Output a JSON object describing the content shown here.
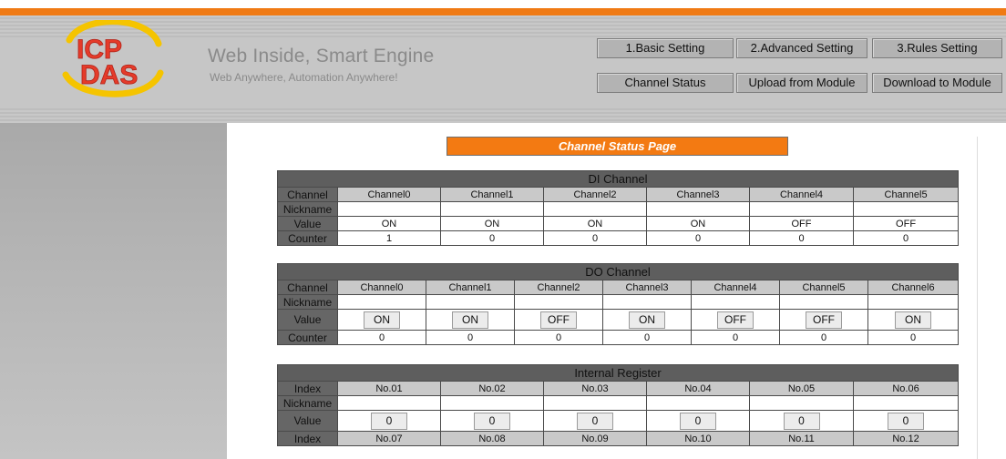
{
  "brand": {
    "logo_text": "ICP DAS",
    "title": "Web Inside, Smart Engine",
    "subtitle": "Web Anywhere, Automation Anywhere!"
  },
  "nav": {
    "row1": [
      "1.Basic Setting",
      "2.Advanced Setting",
      "3.Rules Setting"
    ],
    "row2": [
      "Channel Status",
      "Upload from Module",
      "Download to Module"
    ]
  },
  "page_title": "Channel Status Page",
  "di": {
    "title": "DI Channel",
    "labels": {
      "channel": "Channel",
      "nickname": "Nickname",
      "value": "Value",
      "counter": "Counter"
    },
    "channels": [
      "Channel0",
      "Channel1",
      "Channel2",
      "Channel3",
      "Channel4",
      "Channel5"
    ],
    "values": [
      "ON",
      "ON",
      "ON",
      "ON",
      "OFF",
      "OFF"
    ],
    "counters": [
      "1",
      "0",
      "0",
      "0",
      "0",
      "0"
    ]
  },
  "do": {
    "title": "DO Channel",
    "labels": {
      "channel": "Channel",
      "nickname": "Nickname",
      "value": "Value",
      "counter": "Counter"
    },
    "channels": [
      "Channel0",
      "Channel1",
      "Channel2",
      "Channel3",
      "Channel4",
      "Channel5",
      "Channel6"
    ],
    "values": [
      "ON",
      "ON",
      "OFF",
      "ON",
      "OFF",
      "OFF",
      "ON"
    ],
    "counters": [
      "0",
      "0",
      "0",
      "0",
      "0",
      "0",
      "0"
    ]
  },
  "ir": {
    "title": "Internal Register",
    "labels": {
      "index": "Index",
      "nickname": "Nickname",
      "value": "Value"
    },
    "indexes": [
      "No.01",
      "No.02",
      "No.03",
      "No.04",
      "No.05",
      "No.06"
    ],
    "values": [
      "0",
      "0",
      "0",
      "0",
      "0",
      "0"
    ],
    "indexes2": [
      "No.07",
      "No.08",
      "No.09",
      "No.10",
      "No.11",
      "No.12"
    ]
  },
  "colors": {
    "accent": "#f07a14",
    "header_gray": "#c6c6c6",
    "label_bg": "#666666",
    "section_bg": "#5e5e5e"
  }
}
